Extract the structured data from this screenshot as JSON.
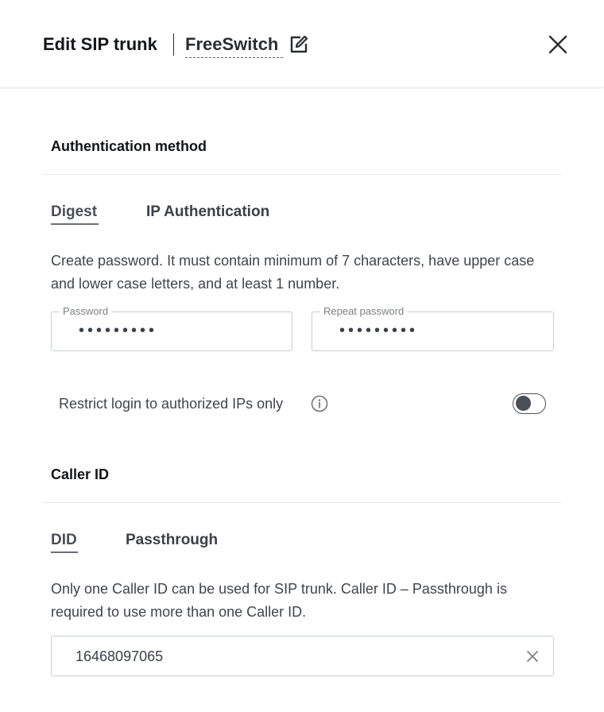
{
  "header": {
    "title": "Edit SIP trunk",
    "trunk_name": "FreeSwitch",
    "edit_icon": "edit-icon",
    "close_icon": "close-icon"
  },
  "auth": {
    "section_title": "Authentication method",
    "tabs": [
      {
        "label": "Digest",
        "active": true
      },
      {
        "label": "IP Authentication",
        "active": false
      }
    ],
    "description": "Create password. It must contain minimum of 7 characters, have upper case and lower case letters, and at least 1 number.",
    "password": {
      "label": "Password",
      "value": "•••••••••"
    },
    "repeat_password": {
      "label": "Repeat password",
      "value": "•••••••••"
    },
    "restrict_label": "Restrict login to authorized IPs only",
    "restrict_enabled": false,
    "info_icon": "info-icon"
  },
  "caller_id": {
    "section_title": "Caller ID",
    "tabs": [
      {
        "label": "DID",
        "active": true
      },
      {
        "label": "Passthrough",
        "active": false
      }
    ],
    "description": "Only one Caller ID can be used for SIP trunk. Caller ID – Passthrough is required to use more than one Caller ID.",
    "did_value": "16468097065",
    "clear_icon": "clear-icon"
  }
}
